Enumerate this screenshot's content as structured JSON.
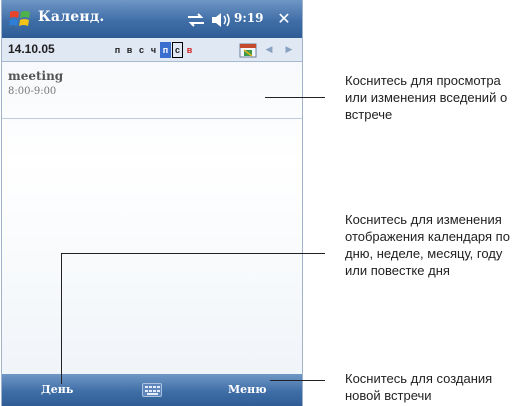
{
  "device": {
    "title_bar": {
      "app_title": "Календ.",
      "time": "9:19",
      "close_label": "✕",
      "start_icon": "windows-flag-icon",
      "connectivity_icon": "connectivity-icon",
      "volume_icon": "volume-icon"
    },
    "date_bar": {
      "date": "14.10.05",
      "days": [
        "п",
        "в",
        "с",
        "ч",
        "п",
        "с",
        "в"
      ],
      "selected_day_index": 4,
      "today_day_index": 5,
      "weekend_color": "#d32020",
      "selected_color": "#3a6fd0",
      "nav_prev": "◀",
      "nav_next": "▶"
    },
    "appointment": {
      "title": "meeting",
      "time": "8:00-9:00"
    },
    "command_bar": {
      "left_label": "День",
      "right_label": "Меню",
      "input_icon": "keyboard-icon"
    },
    "accent_color": "#3f6ea7"
  },
  "callouts": [
    {
      "lines": [
        "Коснитесь для просмотра",
        "или изменения вседений о",
        "встрече"
      ]
    },
    {
      "lines": [
        "Коснитесь для изменения",
        "отображения календаря по",
        "дню, неделе, месяцу, году",
        "или повестке дня"
      ]
    },
    {
      "lines": [
        "Коснитесь для создания",
        "новой встречи"
      ]
    }
  ]
}
